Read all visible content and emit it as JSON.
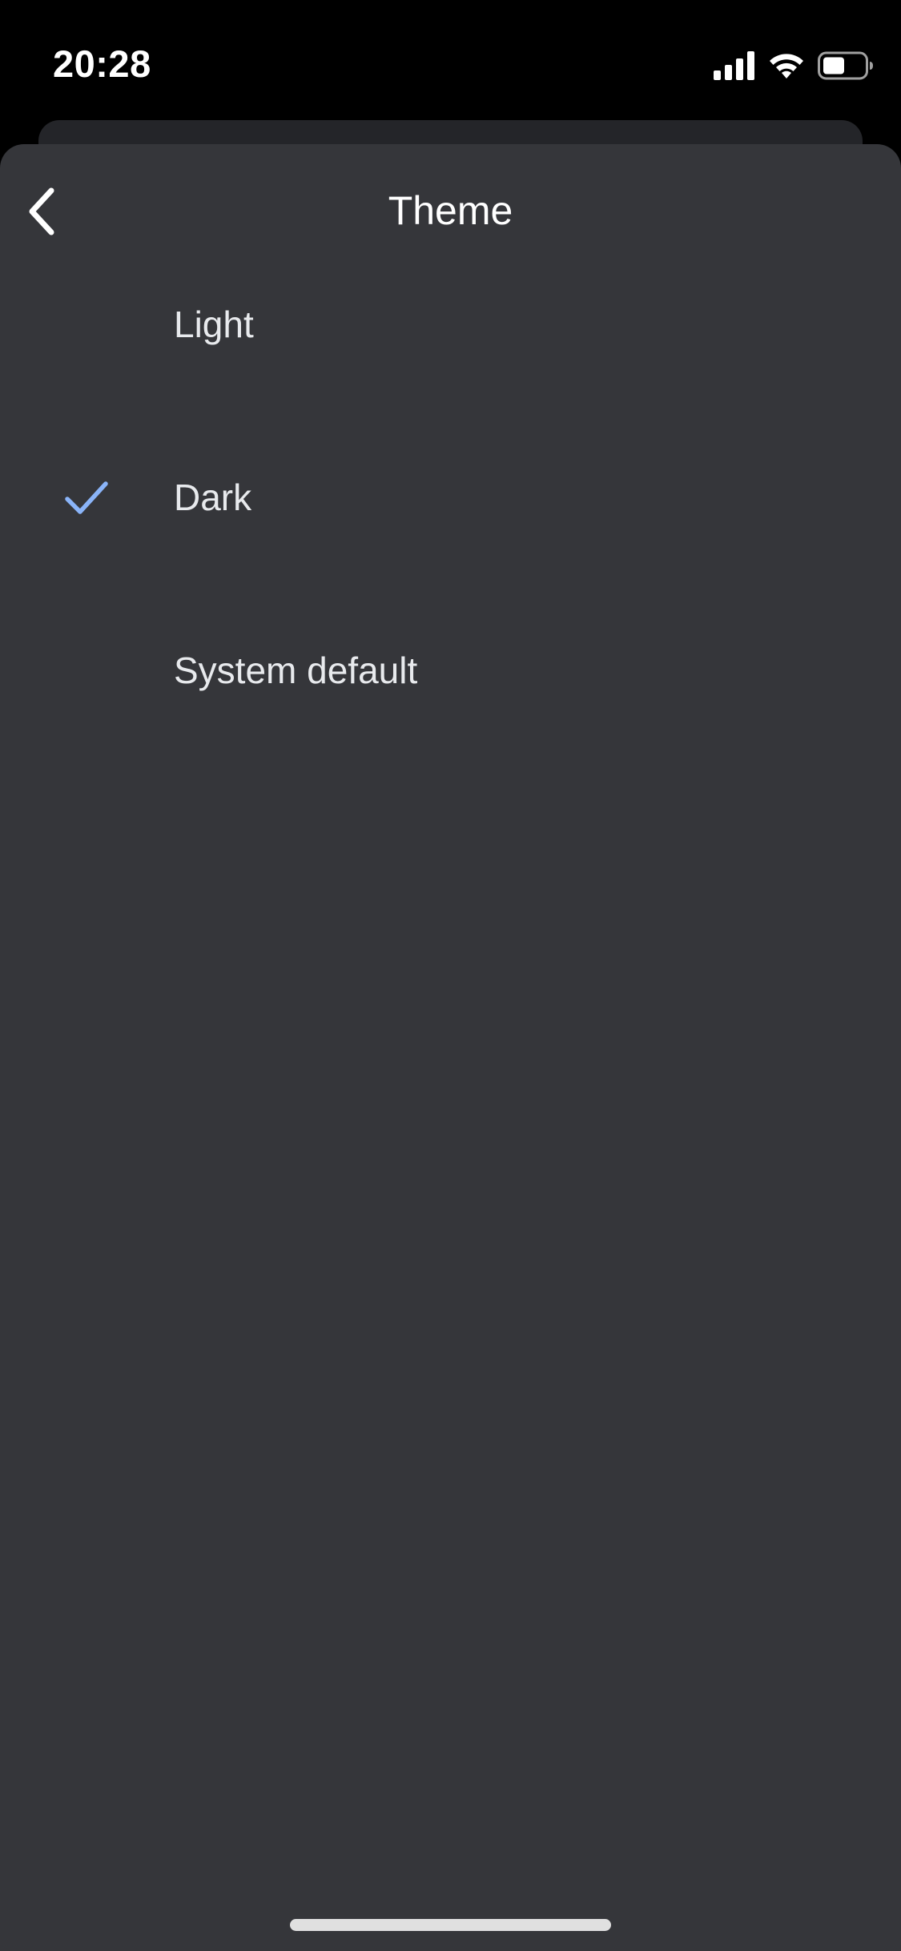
{
  "status_bar": {
    "time": "20:28",
    "icons": [
      "signal-icon",
      "wifi-icon",
      "battery-icon"
    ]
  },
  "header": {
    "back_icon": "chevron-left-icon",
    "title": "Theme"
  },
  "options": [
    {
      "label": "Light",
      "selected": false
    },
    {
      "label": "Dark",
      "selected": true
    },
    {
      "label": "System default",
      "selected": false
    }
  ],
  "colors": {
    "sheet_background": "#35363a",
    "check_accent": "#8ab4f8",
    "text": "#e8eaed"
  }
}
